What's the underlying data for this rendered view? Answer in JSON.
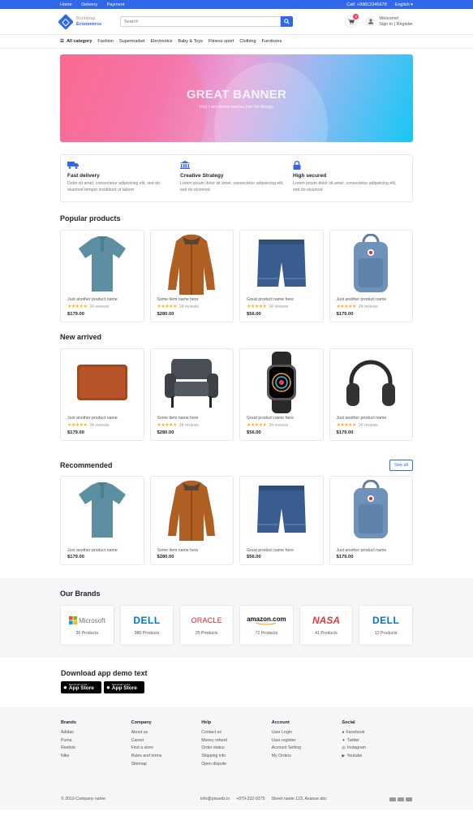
{
  "topbar": {
    "links": [
      "Home",
      "Delivery",
      "Payment"
    ],
    "phone": "Call: +99812345678",
    "language": "English"
  },
  "header": {
    "logo_line1": "Bootstrap",
    "logo_line2": "Ecommerce",
    "search_placeholder": "Search",
    "cart_count": "0",
    "welcome": "Welcome!",
    "signin": "Sign in | Register"
  },
  "nav": {
    "all_label": "All category",
    "items": [
      "Fashion",
      "Supermarket",
      "Electronics",
      "Baby &amp; Toys",
      "Fitness sport",
      "Clothing",
      "Furnitures"
    ]
  },
  "banner": {
    "title": "GREAT BANNER",
    "subtitle": "Hey I am demo banner just for design"
  },
  "features": [
    {
      "icon": "truck-icon",
      "title": "Fast delivery",
      "text": "Dolor sit amet, consectetur adipisicing elit, sed do eiusmod tempor incididunt ut labore"
    },
    {
      "icon": "bank-icon",
      "title": "Creative Strategy",
      "text": "Lorem ipsum dolor sit amet, consectetur adipisicing elit, sed do eiusmod"
    },
    {
      "icon": "lock-icon",
      "title": "High secured",
      "text": "Lorem ipsum dolor sit amet, consectetur adipisicing elit, sed do eiusmod"
    }
  ],
  "popular": {
    "title": "Popular products",
    "items": [
      {
        "img": "polo-shirt",
        "name": "Just another product name",
        "reviews": "34 reviews",
        "price": "$179.00"
      },
      {
        "img": "jacket",
        "name": "Some item name here",
        "reviews": "34 reviews",
        "price": "$280.00"
      },
      {
        "img": "jeans-shorts",
        "name": "Great product name here",
        "reviews": "34 reviews",
        "price": "$56.00"
      },
      {
        "img": "backpack",
        "name": "Just another product name",
        "reviews": "34 reviews",
        "price": "$179.00"
      }
    ]
  },
  "new_arrived": {
    "title": "New arrived",
    "items": [
      {
        "img": "laptop-sleeve",
        "name": "Just another product name",
        "reviews": "34 reviews",
        "price": "$179.00"
      },
      {
        "img": "armchair",
        "name": "Some item name here",
        "reviews": "34 reviews",
        "price": "$280.00"
      },
      {
        "img": "smartwatch",
        "name": "Great product name here",
        "reviews": "34 reviews",
        "price": "$56.00"
      },
      {
        "img": "headphones",
        "name": "Just another product name",
        "reviews": "34 reviews",
        "price": "$179.00"
      }
    ]
  },
  "recommended": {
    "title": "Recommended",
    "see_all": "See all",
    "items": [
      {
        "img": "polo-shirt",
        "name": "Just another product name",
        "price": "$179.00"
      },
      {
        "img": "jacket",
        "name": "Some item name here",
        "price": "$280.00"
      },
      {
        "img": "jeans-shorts",
        "name": "Great product name here",
        "price": "$56.00"
      },
      {
        "img": "backpack",
        "name": "Just another product name",
        "price": "$179.00"
      }
    ]
  },
  "brands": {
    "title": "Our Brands",
    "items": [
      {
        "name": "Microsoft",
        "count": "36 Products"
      },
      {
        "name": "DELL",
        "count": "980 Products"
      },
      {
        "name": "ORACLE",
        "count": "25 Products"
      },
      {
        "name": "amazon.com",
        "count": "72 Products"
      },
      {
        "name": "NASA",
        "count": "41 Products"
      },
      {
        "name": "DELL",
        "count": "12 Products"
      }
    ]
  },
  "download": {
    "title": "Download app demo text",
    "store_small": "Download on the",
    "store_big": "App Store"
  },
  "footer": {
    "cols": [
      {
        "title": "Brands",
        "links": [
          "Adidas",
          "Puma",
          "Reebok",
          "Nike"
        ]
      },
      {
        "title": "Company",
        "links": [
          "About us",
          "Career",
          "Find a store",
          "Rules and terms",
          "Sitemap"
        ]
      },
      {
        "title": "Help",
        "links": [
          "Contact us",
          "Money refund",
          "Order status",
          "Shipping info",
          "Open dispute"
        ]
      },
      {
        "title": "Account",
        "links": [
          "User Login",
          "User register",
          "Account Setting",
          "My Orders"
        ]
      },
      {
        "title": "Social",
        "links": [
          "Facebook",
          "Twitter",
          "Instagram",
          "Youtube"
        ]
      }
    ],
    "copyright": "© 2019 Company name",
    "email": "info@pixsellz.io",
    "phone": "+879-332-9375",
    "address": "Street name 123, Avanue abc"
  },
  "colors": {
    "accent": "#3167eb",
    "star": "#ffb020",
    "badge": "#f43f5e"
  }
}
